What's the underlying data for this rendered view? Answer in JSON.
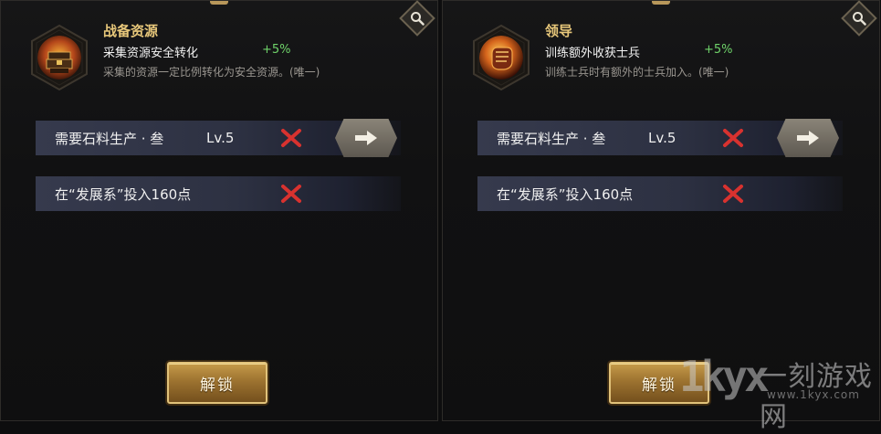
{
  "panels": [
    {
      "skill_name": "战备资源",
      "effect": "采集资源安全转化",
      "bonus": "+5%",
      "description": "采集的资源一定比例转化为安全资源。(唯一)",
      "requirements": [
        {
          "text": "需要石料生产 · 叁",
          "level": "Lv.5",
          "met": false,
          "has_go": true
        },
        {
          "text": "在“发展系”投入160点",
          "level": "",
          "met": false,
          "has_go": false
        }
      ],
      "unlock_label": "解锁",
      "icon": "treasure-chest-icon"
    },
    {
      "skill_name": "领导",
      "effect": "训练额外收获士兵",
      "bonus": "+5%",
      "description": "训练士兵时有额外的士兵加入。(唯一)",
      "requirements": [
        {
          "text": "需要石料生产 · 叁",
          "level": "Lv.5",
          "met": false,
          "has_go": true
        },
        {
          "text": "在“发展系”投入160点",
          "level": "",
          "met": false,
          "has_go": false
        }
      ],
      "unlock_label": "解锁",
      "icon": "fist-icon"
    }
  ],
  "watermark": {
    "logo": "1kyx",
    "name": "一刻游戏网",
    "url": "www.1kyx.com"
  },
  "colors": {
    "accent": "#e7c77a",
    "bonus": "#6fd36a",
    "fail": "#d8322f",
    "row": "#363a4d"
  }
}
